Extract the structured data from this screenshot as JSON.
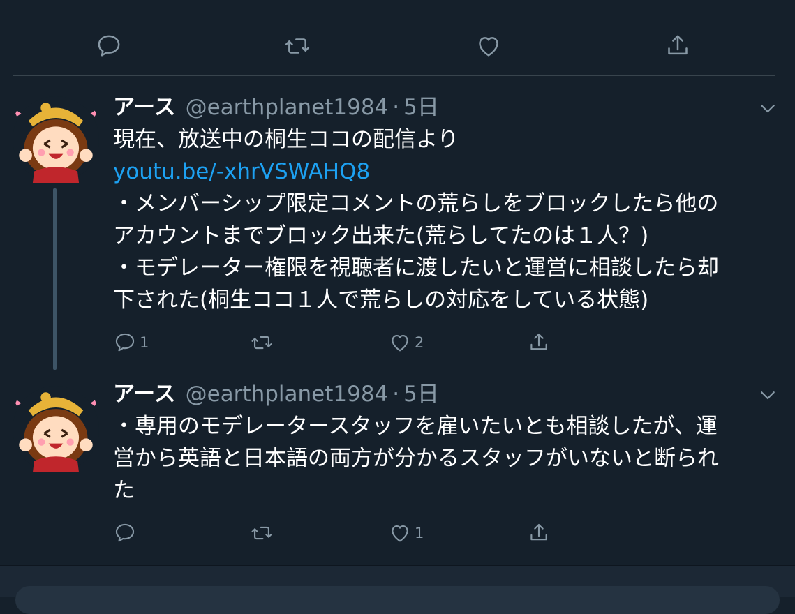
{
  "top_actions": {
    "reply_icon": "reply-icon",
    "retweet_icon": "retweet-icon",
    "like_icon": "heart-icon",
    "share_icon": "share-icon"
  },
  "tweets": [
    {
      "name": "アース",
      "handle": "@earthplanet1984",
      "separator": "·",
      "time": "5日",
      "lines": [
        "現在、放送中の桐生ココの配信より",
        "youtu.be/-xhrVSWAHQ8",
        "・メンバーシップ限定コメントの荒らしをブロックしたら他の",
        "アカウントまでブロック出来た(荒らしてたのは１人？)",
        "・モデレーター権限を視聴者に渡したいと運営に相談したら却",
        "下された(桐生ココ１人で荒らしの対応をしている状態)"
      ],
      "reply_count": "1",
      "retweet_count": "",
      "like_count": "2"
    },
    {
      "name": "アース",
      "handle": "@earthplanet1984",
      "separator": "·",
      "time": "5日",
      "lines": [
        "・専用のモデレータースタッフを雇いたいとも相談したが、運",
        "営から英語と日本語の両方が分かるスタッフがいないと断られ",
        "た"
      ],
      "reply_count": "",
      "retweet_count": "",
      "like_count": "1"
    }
  ],
  "colors": {
    "background": "#15202b",
    "muted": "#8899a6",
    "link": "#1da1f2",
    "divider": "#38444d"
  }
}
